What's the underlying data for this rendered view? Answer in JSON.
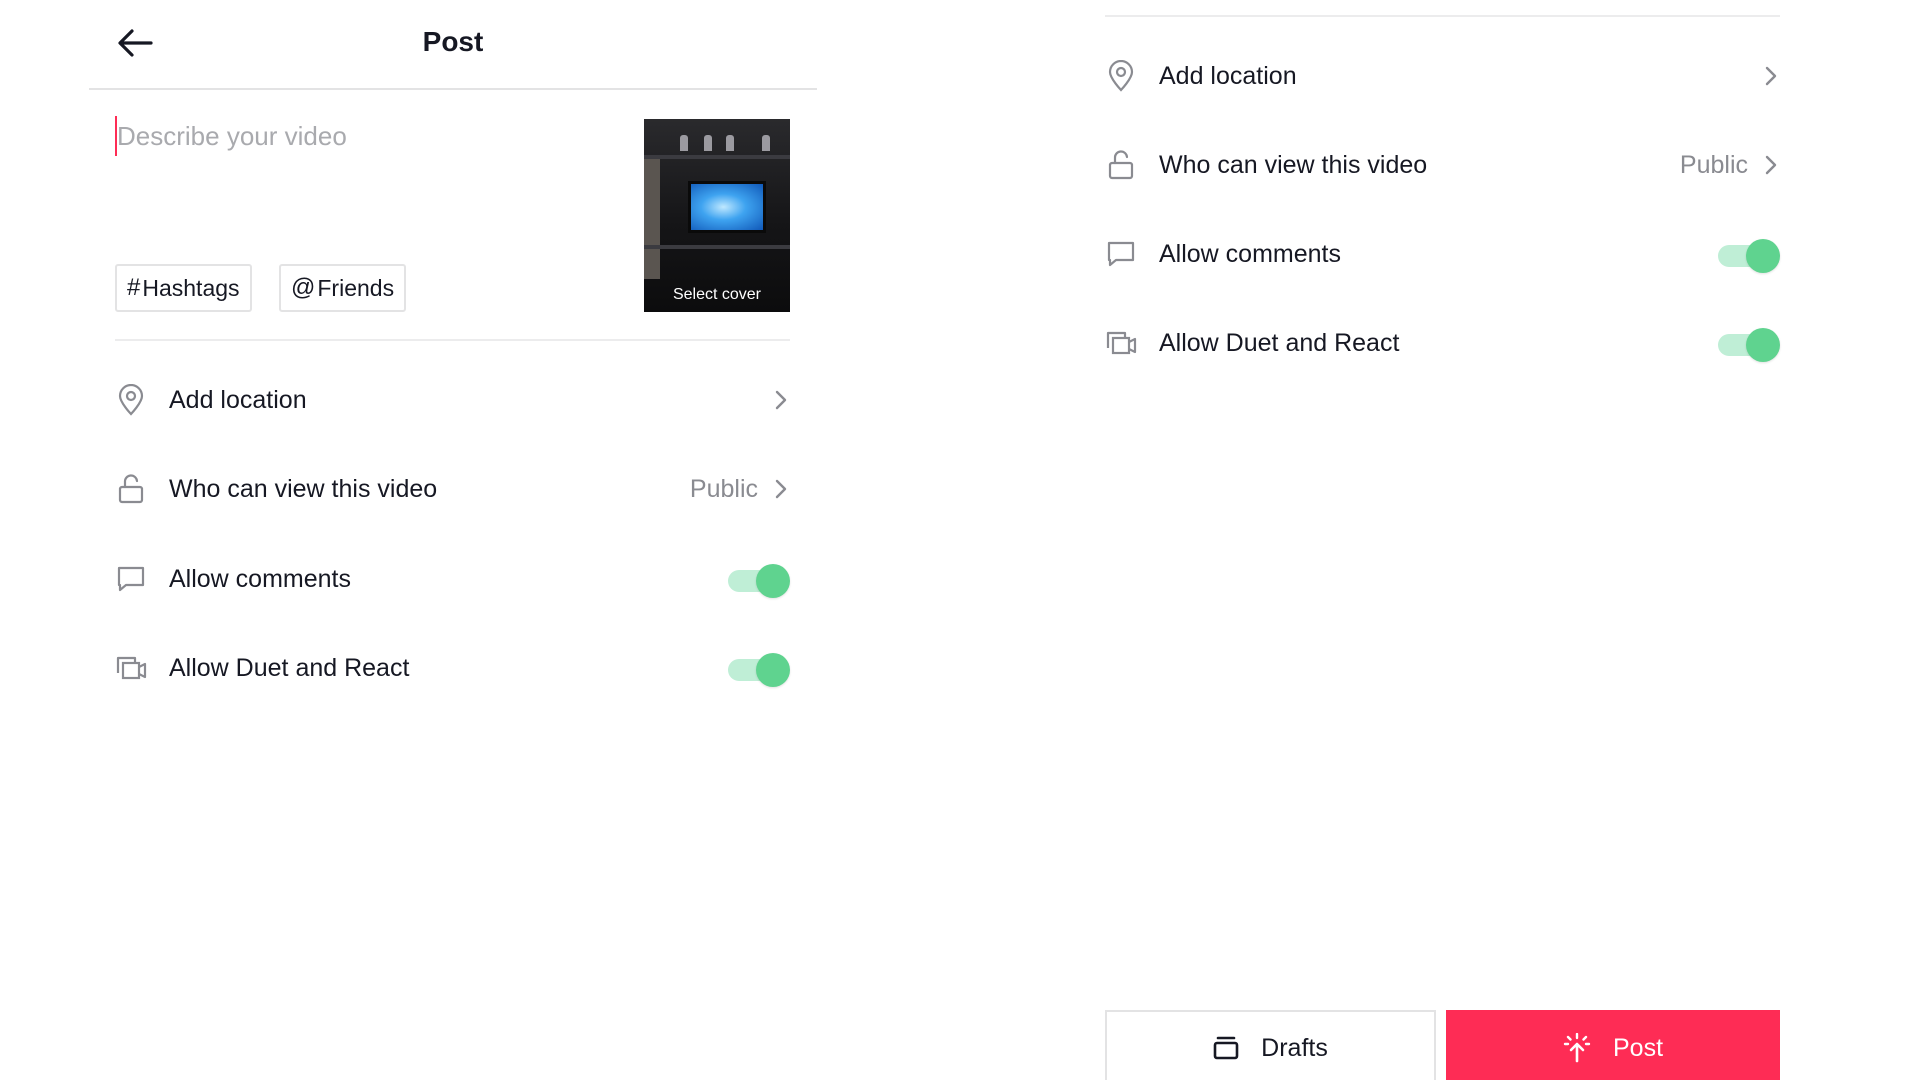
{
  "left": {
    "header": {
      "title": "Post"
    },
    "description": {
      "placeholder": "Describe your video"
    },
    "cover": {
      "label": "Select cover"
    },
    "chips": [
      {
        "symbol": "#",
        "label": "Hashtags"
      },
      {
        "symbol": "@",
        "label": "Friends"
      }
    ],
    "rows": {
      "location": {
        "label": "Add location"
      },
      "privacy": {
        "label": "Who can view this video",
        "value": "Public"
      },
      "comments": {
        "label": "Allow comments",
        "on": true
      },
      "duet": {
        "label": "Allow Duet and React",
        "on": true
      }
    }
  },
  "right": {
    "rows": {
      "location": {
        "label": "Add location"
      },
      "privacy": {
        "label": "Who can view this video",
        "value": "Public"
      },
      "comments": {
        "label": "Allow comments",
        "on": true
      },
      "duet": {
        "label": "Allow Duet and React",
        "on": true
      }
    },
    "buttons": {
      "drafts": "Drafts",
      "post": "Post"
    }
  },
  "colors": {
    "accent": "#fe2c55",
    "toggle_on": "#5fd38f",
    "toggle_track": "#bfeed6",
    "muted_text": "#8a8b91"
  },
  "icons": [
    "back-arrow-icon",
    "location-pin-icon",
    "unlock-icon",
    "comment-icon",
    "duet-icon",
    "chevron-right-icon",
    "drafts-icon",
    "post-upload-icon"
  ]
}
